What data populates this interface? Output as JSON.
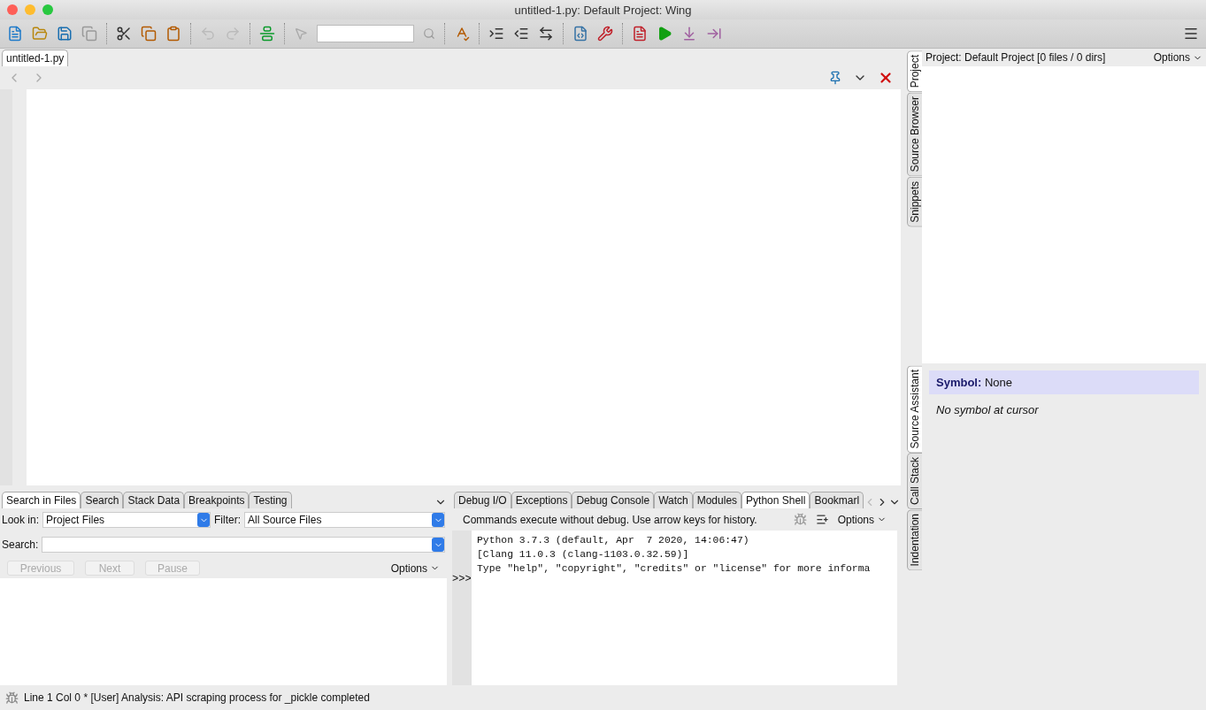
{
  "window": {
    "title": "untitled-1.py: Default Project: Wing"
  },
  "editor": {
    "tabs": [
      {
        "label": "untitled-1.py",
        "selected": true
      }
    ]
  },
  "search_panel": {
    "tabs": [
      {
        "label": "Search in Files",
        "selected": true
      },
      {
        "label": "Search",
        "selected": false
      },
      {
        "label": "Stack Data",
        "selected": false
      },
      {
        "label": "Breakpoints",
        "selected": false
      },
      {
        "label": "Testing",
        "selected": false
      }
    ],
    "look_in": {
      "label": "Look in:",
      "value": "Project Files"
    },
    "filter": {
      "label": "Filter:",
      "value": "All Source Files"
    },
    "search": {
      "label": "Search:"
    },
    "buttons": [
      {
        "label": "Previous",
        "disabled": true
      },
      {
        "label": "Next",
        "disabled": true
      },
      {
        "label": "Pause",
        "disabled": true
      }
    ],
    "options": "Options"
  },
  "shell_panel": {
    "tabs": [
      {
        "label": "Debug I/O",
        "selected": false
      },
      {
        "label": "Exceptions",
        "selected": false
      },
      {
        "label": "Debug Console",
        "selected": false
      },
      {
        "label": "Watch",
        "selected": false
      },
      {
        "label": "Modules",
        "selected": false
      },
      {
        "label": "Python Shell",
        "selected": true
      },
      {
        "label": "Bookmarl",
        "selected": false
      }
    ],
    "hint": "Commands execute without debug.  Use arrow keys for history.",
    "options": "Options",
    "lines": [
      "Python 3.7.3 (default, Apr  7 2020, 14:06:47)",
      "[Clang 11.0.3 (clang-1103.0.32.59)]",
      "Type \"help\", \"copyright\", \"credits\" or \"license\" for more informa"
    ],
    "prompt": ">>>"
  },
  "project_panel": {
    "tabs": [
      {
        "label": "Project",
        "selected": true
      },
      {
        "label": "Source Browser",
        "selected": false
      },
      {
        "label": "Snippets",
        "selected": false
      }
    ],
    "header": "Project: Default Project [0 files / 0 dirs]",
    "options": "Options"
  },
  "assistant_panel": {
    "tabs": [
      {
        "label": "Source Assistant",
        "selected": true
      },
      {
        "label": "Call Stack",
        "selected": false
      },
      {
        "label": "Indentation",
        "selected": false
      }
    ],
    "symbol_label": "Symbol:",
    "symbol_value": "None",
    "note": "No symbol at cursor"
  },
  "status_bar": {
    "text": "Line 1 Col 0 * [User] Analysis: API scraping process for _pickle completed"
  }
}
